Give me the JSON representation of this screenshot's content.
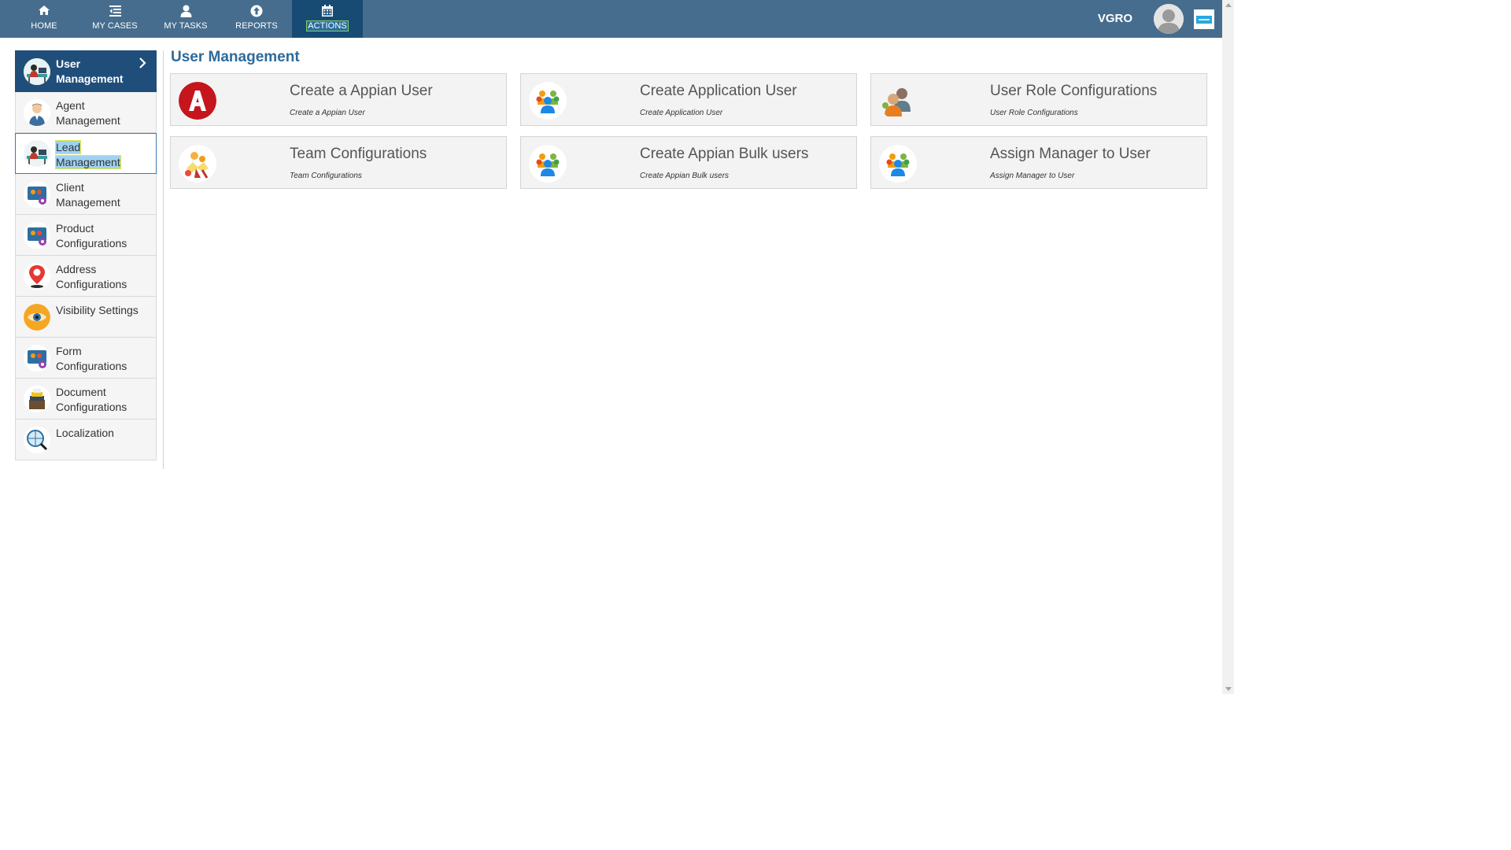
{
  "nav": {
    "items": [
      {
        "label": "HOME",
        "icon": "home-icon"
      },
      {
        "label": "MY CASES",
        "icon": "list-icon"
      },
      {
        "label": "MY TASKS",
        "icon": "person-icon"
      },
      {
        "label": "REPORTS",
        "icon": "arrow-up-circle-icon"
      },
      {
        "label": "ACTIONS",
        "icon": "calendar-icon",
        "active": true
      }
    ],
    "user_name": "VGRO"
  },
  "sidebar": {
    "items": [
      {
        "label_1": "User",
        "label_2": "Management",
        "icon": "user-management-icon",
        "selected": true
      },
      {
        "label_1": "Agent",
        "label_2": "Management",
        "icon": "agent-icon"
      },
      {
        "label_1": "Lead",
        "label_2": "Management",
        "icon": "lead-icon",
        "focused": true
      },
      {
        "label_1": "Client",
        "label_2": "Management",
        "icon": "client-icon"
      },
      {
        "label_1": "Product",
        "label_2": "Configurations",
        "icon": "product-icon"
      },
      {
        "label_1": "Address",
        "label_2": "Configurations",
        "icon": "map-pin-icon"
      },
      {
        "label_1": "Visibility Settings",
        "label_2": "",
        "icon": "eye-icon"
      },
      {
        "label_1": "Form",
        "label_2": "Configurations",
        "icon": "form-icon"
      },
      {
        "label_1": "Document",
        "label_2": "Configurations",
        "icon": "document-icon"
      },
      {
        "label_1": "Localization",
        "label_2": "",
        "icon": "globe-search-icon"
      }
    ]
  },
  "main": {
    "title": "User Management",
    "cards": [
      {
        "title": "Create a Appian User",
        "subtitle": "Create a Appian User",
        "icon": "appian-logo-icon"
      },
      {
        "title": "Create Application User",
        "subtitle": "Create Application User",
        "icon": "group-icon"
      },
      {
        "title": "User Role Configurations",
        "subtitle": "User Role Configurations",
        "icon": "users-pair-icon"
      },
      {
        "title": "Team Configurations",
        "subtitle": "Team Configurations",
        "icon": "team-celebrate-icon"
      },
      {
        "title": "Create Appian Bulk users",
        "subtitle": "Create Appian Bulk users",
        "icon": "group-icon"
      },
      {
        "title": "Assign Manager to User",
        "subtitle": "Assign Manager to User",
        "icon": "group-icon"
      }
    ]
  },
  "colors": {
    "topbar": "#466d8e",
    "active_tab": "#174b74",
    "selected_sidebar": "#1f4e7a",
    "title_blue": "#2c6b9c"
  }
}
